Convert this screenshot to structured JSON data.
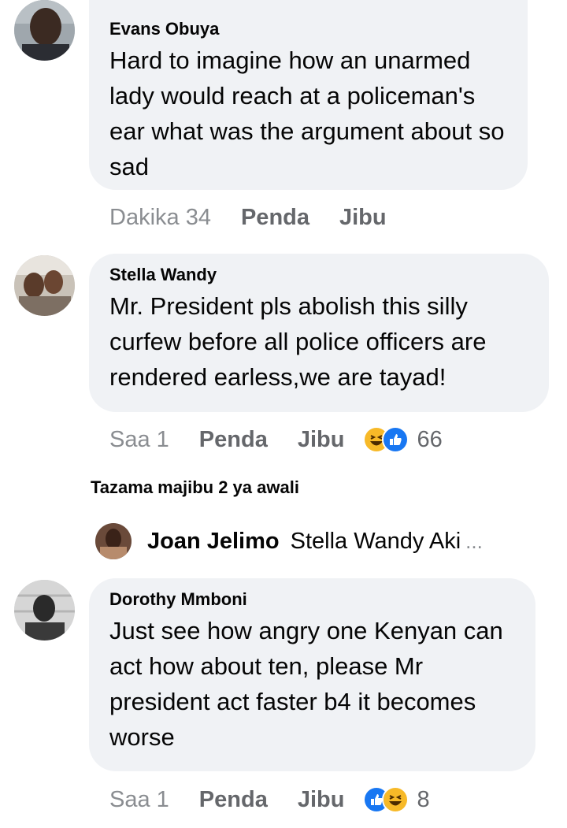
{
  "comments": [
    {
      "author": "Evans Obuya",
      "text": "Hard to imagine how an unarmed lady would reach at a policeman's ear what was the argument about so sad",
      "time": "Dakika 34",
      "like_label": "Penda",
      "reply_label": "Jibu"
    },
    {
      "author": "Stella Wandy",
      "text": "Mr. President pls abolish this silly curfew before all police officers are rendered earless,we are tayad!",
      "time": "Saa 1",
      "like_label": "Penda",
      "reply_label": "Jibu",
      "reactions": [
        "haha",
        "like"
      ],
      "reaction_count": "66"
    },
    {
      "author": "Dorothy Mmboni",
      "text": "Just see how  angry one Kenyan can act how about ten, please Mr president act faster b4 it becomes worse",
      "time": "Saa 1",
      "like_label": "Penda",
      "reply_label": "Jibu",
      "reactions": [
        "like",
        "haha"
      ],
      "reaction_count": "8"
    }
  ],
  "view_previous_replies": "Tazama majibu 2 ya awali",
  "reply_preview": {
    "author": "Joan Jelimo",
    "text": "Stella Wandy Aki",
    "ellipsis": "..."
  },
  "colors": {
    "bubble": "#f0f2f5",
    "like_blue": "#1877f2",
    "haha_yellow": "#f7b928",
    "secondary_text": "#65676b"
  }
}
